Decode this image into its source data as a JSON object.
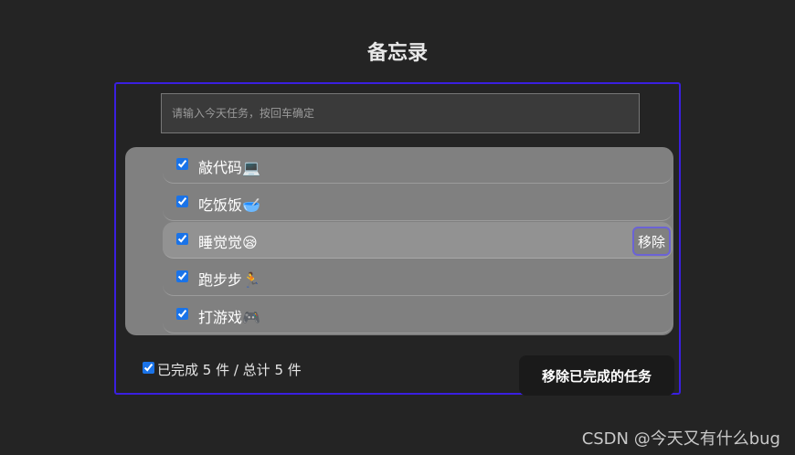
{
  "app": {
    "title": "备忘录"
  },
  "input": {
    "placeholder": "请输入今天任务，按回车确定",
    "value": ""
  },
  "tasks": [
    {
      "label": "敲代码💻",
      "done": true
    },
    {
      "label": "吃饭饭🥣",
      "done": true
    },
    {
      "label": "睡觉觉😪",
      "done": true
    },
    {
      "label": "跑步步🏃",
      "done": true
    },
    {
      "label": "打游戏🎮",
      "done": true
    }
  ],
  "task_remove_label": "移除",
  "footer": {
    "all_checked": true,
    "summary": "已完成 5 件 / 总计 5 件",
    "clear_label": "移除已完成的任务"
  },
  "watermark": "CSDN @今天又有什么bug",
  "colors": {
    "background": "#242424",
    "card_border": "#3a1fe0",
    "list_bg": "#808080",
    "remove_border": "#6b63d6"
  }
}
